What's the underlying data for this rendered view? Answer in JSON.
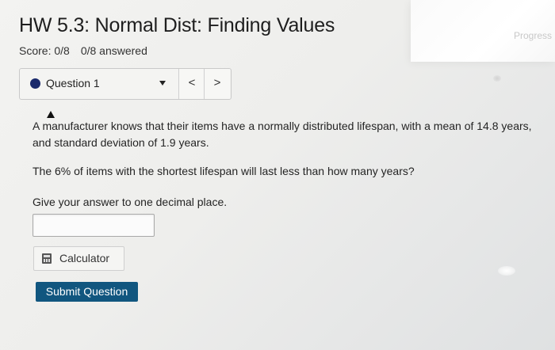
{
  "header": {
    "title": "HW 5.3: Normal Dist: Finding Values",
    "score": "Score: 0/8",
    "answered": "0/8 answered",
    "progress_label": "Progress"
  },
  "question_nav": {
    "selected_question": "Question 1",
    "prev_glyph": "<",
    "next_glyph": ">"
  },
  "question": {
    "text_1": "A manufacturer knows that their items have a normally distributed lifespan, with a mean of 14.8 years, and standard deviation of 1.9 years.",
    "text_2": "The 6% of items with the shortest lifespan will last less than how many years?",
    "text_3": "Give your answer to one decimal place."
  },
  "answer_input": {
    "value": ""
  },
  "buttons": {
    "calculator_label": "Calculator",
    "submit_label": "Submit Question"
  },
  "colors": {
    "submit_bg": "#11567f",
    "question_dot": "#1a2a6c"
  }
}
